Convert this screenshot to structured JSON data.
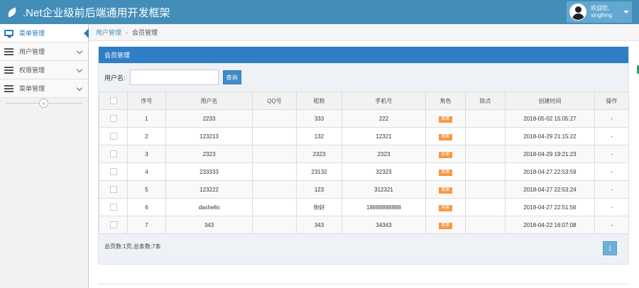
{
  "app": {
    "title": ".Net企业级前后端通用开发框架"
  },
  "user": {
    "greeting": "欢迎您,",
    "name": "xingfeng"
  },
  "sidebar": {
    "items": [
      {
        "label": "菜单管理",
        "icon": "desktop-icon",
        "active": true
      },
      {
        "label": "用户管理",
        "icon": "list-icon",
        "active": false
      },
      {
        "label": "权限管理",
        "icon": "list-icon",
        "active": false
      },
      {
        "label": "菜单管理",
        "icon": "list-icon",
        "active": false
      }
    ],
    "collapse_glyph": "«"
  },
  "breadcrumb": {
    "parent": "用户管理",
    "separator": "›",
    "current": "会员管理"
  },
  "panel": {
    "title": "会员管理",
    "search_label": "用户名:",
    "search_value": "",
    "search_button": "查询"
  },
  "table": {
    "columns": [
      "序号",
      "用户名",
      "QQ号",
      "昵称",
      "手机号",
      "角色",
      "除点",
      "创建时间",
      "操作"
    ],
    "rows": [
      {
        "no": "1",
        "username": "2233",
        "qq": "",
        "nickname": "333",
        "phone": "222",
        "role": "商家",
        "extra": "",
        "created": "2018-05-02 15:05:27",
        "op": "-"
      },
      {
        "no": "2",
        "username": "123213",
        "qq": "",
        "nickname": "132",
        "phone": "12321",
        "role": "商家",
        "extra": "",
        "created": "2018-04-29 21:15:22",
        "op": "-"
      },
      {
        "no": "3",
        "username": "2323",
        "qq": "",
        "nickname": "2323",
        "phone": "2323",
        "role": "买家",
        "extra": "",
        "created": "2018-04-29 19:21:23",
        "op": "-"
      },
      {
        "no": "4",
        "username": "233333",
        "qq": "",
        "nickname": "23132",
        "phone": "32323",
        "role": "商家",
        "extra": "",
        "created": "2018-04-27 22:53:59",
        "op": "-"
      },
      {
        "no": "5",
        "username": "123222",
        "qq": "",
        "nickname": "123",
        "phone": "312321",
        "role": "商家",
        "extra": "",
        "created": "2018-04-27 22:53:24",
        "op": "-"
      },
      {
        "no": "6",
        "username": "daxhello",
        "qq": "",
        "nickname": "你好",
        "phone": "18888888888",
        "role": "商家",
        "extra": "",
        "created": "2018-04-27 22:51:56",
        "op": "-"
      },
      {
        "no": "7",
        "username": "343",
        "qq": "",
        "nickname": "343",
        "phone": "34343",
        "role": "商家",
        "extra": "",
        "created": "2018-04-22 16:07:08",
        "op": "-"
      }
    ]
  },
  "pagination": {
    "summary": "总页数:1页,总条数:7条",
    "current_page": "1"
  },
  "colors": {
    "navbar": "#438eb9",
    "panel_header": "#2f7dc6",
    "role_badge": "#f59942",
    "accent": "#2b7dbc"
  }
}
